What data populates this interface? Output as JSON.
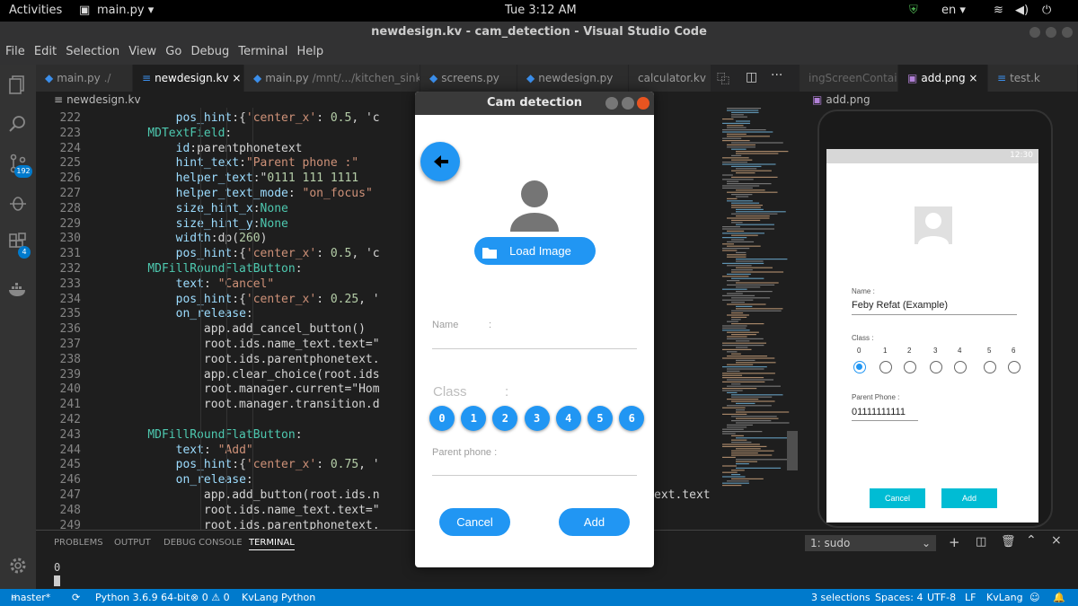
{
  "topbar": {
    "activities": "Activities",
    "app_name": "main.py ▾",
    "clock": "Tue  3:12 AM",
    "lang": "en ▾"
  },
  "window": {
    "title": "newdesign.kv - cam_detection - Visual Studio Code"
  },
  "menu": [
    "File",
    "Edit",
    "Selection",
    "View",
    "Go",
    "Debug",
    "Terminal",
    "Help"
  ],
  "activity": {
    "source_control_badge": "192",
    "extensions_badge": "4"
  },
  "tabs": [
    {
      "label": "main.py",
      "detail": "./"
    },
    {
      "label": "newdesign.kv",
      "detail": ""
    },
    {
      "label": "main.py",
      "detail": "/mnt/.../kitchen_sink"
    },
    {
      "label": "screens.py",
      "detail": ""
    },
    {
      "label": "newdesign.py",
      "detail": ""
    },
    {
      "label": "calculator.kv",
      "detail": ""
    },
    {
      "label": "ingScreenContaint",
      "detail": ""
    },
    {
      "label": "add.png",
      "detail": ""
    },
    {
      "label": "test.k",
      "detail": ""
    }
  ],
  "breadcrumb": "newdesign.kv",
  "right_breadcrumb": "add.png",
  "code_lines": [
    {
      "n": "222",
      "t": "        pos_hint:{'center_x': 0.5, 'c"
    },
    {
      "n": "223",
      "t": "    MDTextField:"
    },
    {
      "n": "224",
      "t": "        id:parentphonetext"
    },
    {
      "n": "225",
      "t": "        hint_text:\"Parent phone :\""
    },
    {
      "n": "226",
      "t": "        helper_text:\"0111 111 1111"
    },
    {
      "n": "227",
      "t": "        helper_text_mode: \"on_focus\""
    },
    {
      "n": "228",
      "t": "        size_hint_x:None"
    },
    {
      "n": "229",
      "t": "        size_hint_y:None"
    },
    {
      "n": "230",
      "t": "        width:dp(260)"
    },
    {
      "n": "231",
      "t": "        pos_hint:{'center_x': 0.5, 'c"
    },
    {
      "n": "232",
      "t": "    MDFillRoundFlatButton:"
    },
    {
      "n": "233",
      "t": "        text: \"Cancel\""
    },
    {
      "n": "234",
      "t": "        pos_hint:{'center_x': 0.25, '"
    },
    {
      "n": "235",
      "t": "        on_release:"
    },
    {
      "n": "236",
      "t": "            app.add_cancel_button()"
    },
    {
      "n": "237",
      "t": "            root.ids.name_text.text=\""
    },
    {
      "n": "238",
      "t": "            root.ids.parentphonetext."
    },
    {
      "n": "239",
      "t": "            app.clear_choice(root.ids"
    },
    {
      "n": "240",
      "t": "            root.manager.current=\"Hom"
    },
    {
      "n": "241",
      "t": "            root.manager.transition.d"
    },
    {
      "n": "242",
      "t": ""
    },
    {
      "n": "243",
      "t": "    MDFillRoundFlatButton:"
    },
    {
      "n": "244",
      "t": "        text: \"Add\""
    },
    {
      "n": "245",
      "t": "        pos_hint:{'center_x': 0.75, '"
    },
    {
      "n": "246",
      "t": "        on_release:"
    },
    {
      "n": "247",
      "t": "            app.add_button(root.ids.n"
    },
    {
      "n": "248",
      "t": "            root.ids.name_text.text=\""
    },
    {
      "n": "249",
      "t": "            root.ids.parentphonetext."
    }
  ],
  "code_overflow": "ext.text",
  "panel": {
    "tabs": [
      "PROBLEMS",
      "OUTPUT",
      "DEBUG CONSOLE",
      "TERMINAL"
    ],
    "terminal_select": "1: sudo",
    "terminal_output": "0"
  },
  "statusbar": {
    "branch": "master*",
    "python": "Python 3.6.9 64-bit",
    "errors": "⊗ 0 ⚠ 0",
    "language_mode": "KvLang Python",
    "selections": "3 selections",
    "spaces": "Spaces: 4",
    "encoding": "UTF-8",
    "eol": "LF",
    "language": "KvLang"
  },
  "cam": {
    "title": "Cam detection",
    "load_image": "Load Image",
    "name_label": "Name",
    "name_colon": ":",
    "class_label": "Class",
    "class_colon": ":",
    "classes": [
      "0",
      "1",
      "2",
      "3",
      "4",
      "5",
      "6"
    ],
    "parent_phone_label": "Parent phone :",
    "cancel": "Cancel",
    "add": "Add"
  },
  "preview": {
    "status_time": "12:30",
    "name_label": "Name :",
    "name_value": "Feby Refat (Example)",
    "class_label": "Class :",
    "class_numbers": [
      "0",
      "1",
      "2",
      "3",
      "4",
      "5",
      "6"
    ],
    "selected_class": "0",
    "phone_label": "Parent Phone :",
    "phone_value": "01111111111",
    "cancel": "Cancel",
    "add": "Add"
  },
  "colors": {
    "accent": "#2196f3",
    "statusbar": "#007acc",
    "teal": "#00bcd4"
  }
}
